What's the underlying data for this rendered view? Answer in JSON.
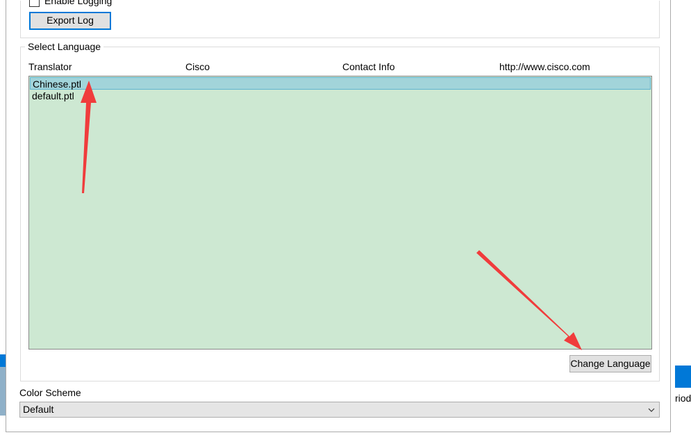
{
  "background": {
    "right_partial_text": "riod"
  },
  "logging": {
    "checkbox_label": "Enable Logging",
    "export_button": "Export Log"
  },
  "language": {
    "group_title": "Select Language",
    "columns": [
      "Translator",
      "Cisco",
      "Contact Info",
      "http://www.cisco.com"
    ],
    "items": [
      {
        "label": "Chinese.ptl",
        "selected": true
      },
      {
        "label": "default.ptl",
        "selected": false
      }
    ],
    "change_button": "Change Language"
  },
  "color_scheme": {
    "label": "Color Scheme",
    "selected": "Default"
  },
  "colors": {
    "list_bg": "#cde8d2",
    "selected_bg": "#a2d4da",
    "annotation_arrow": "#f03c3c",
    "accent": "#0078d7"
  }
}
